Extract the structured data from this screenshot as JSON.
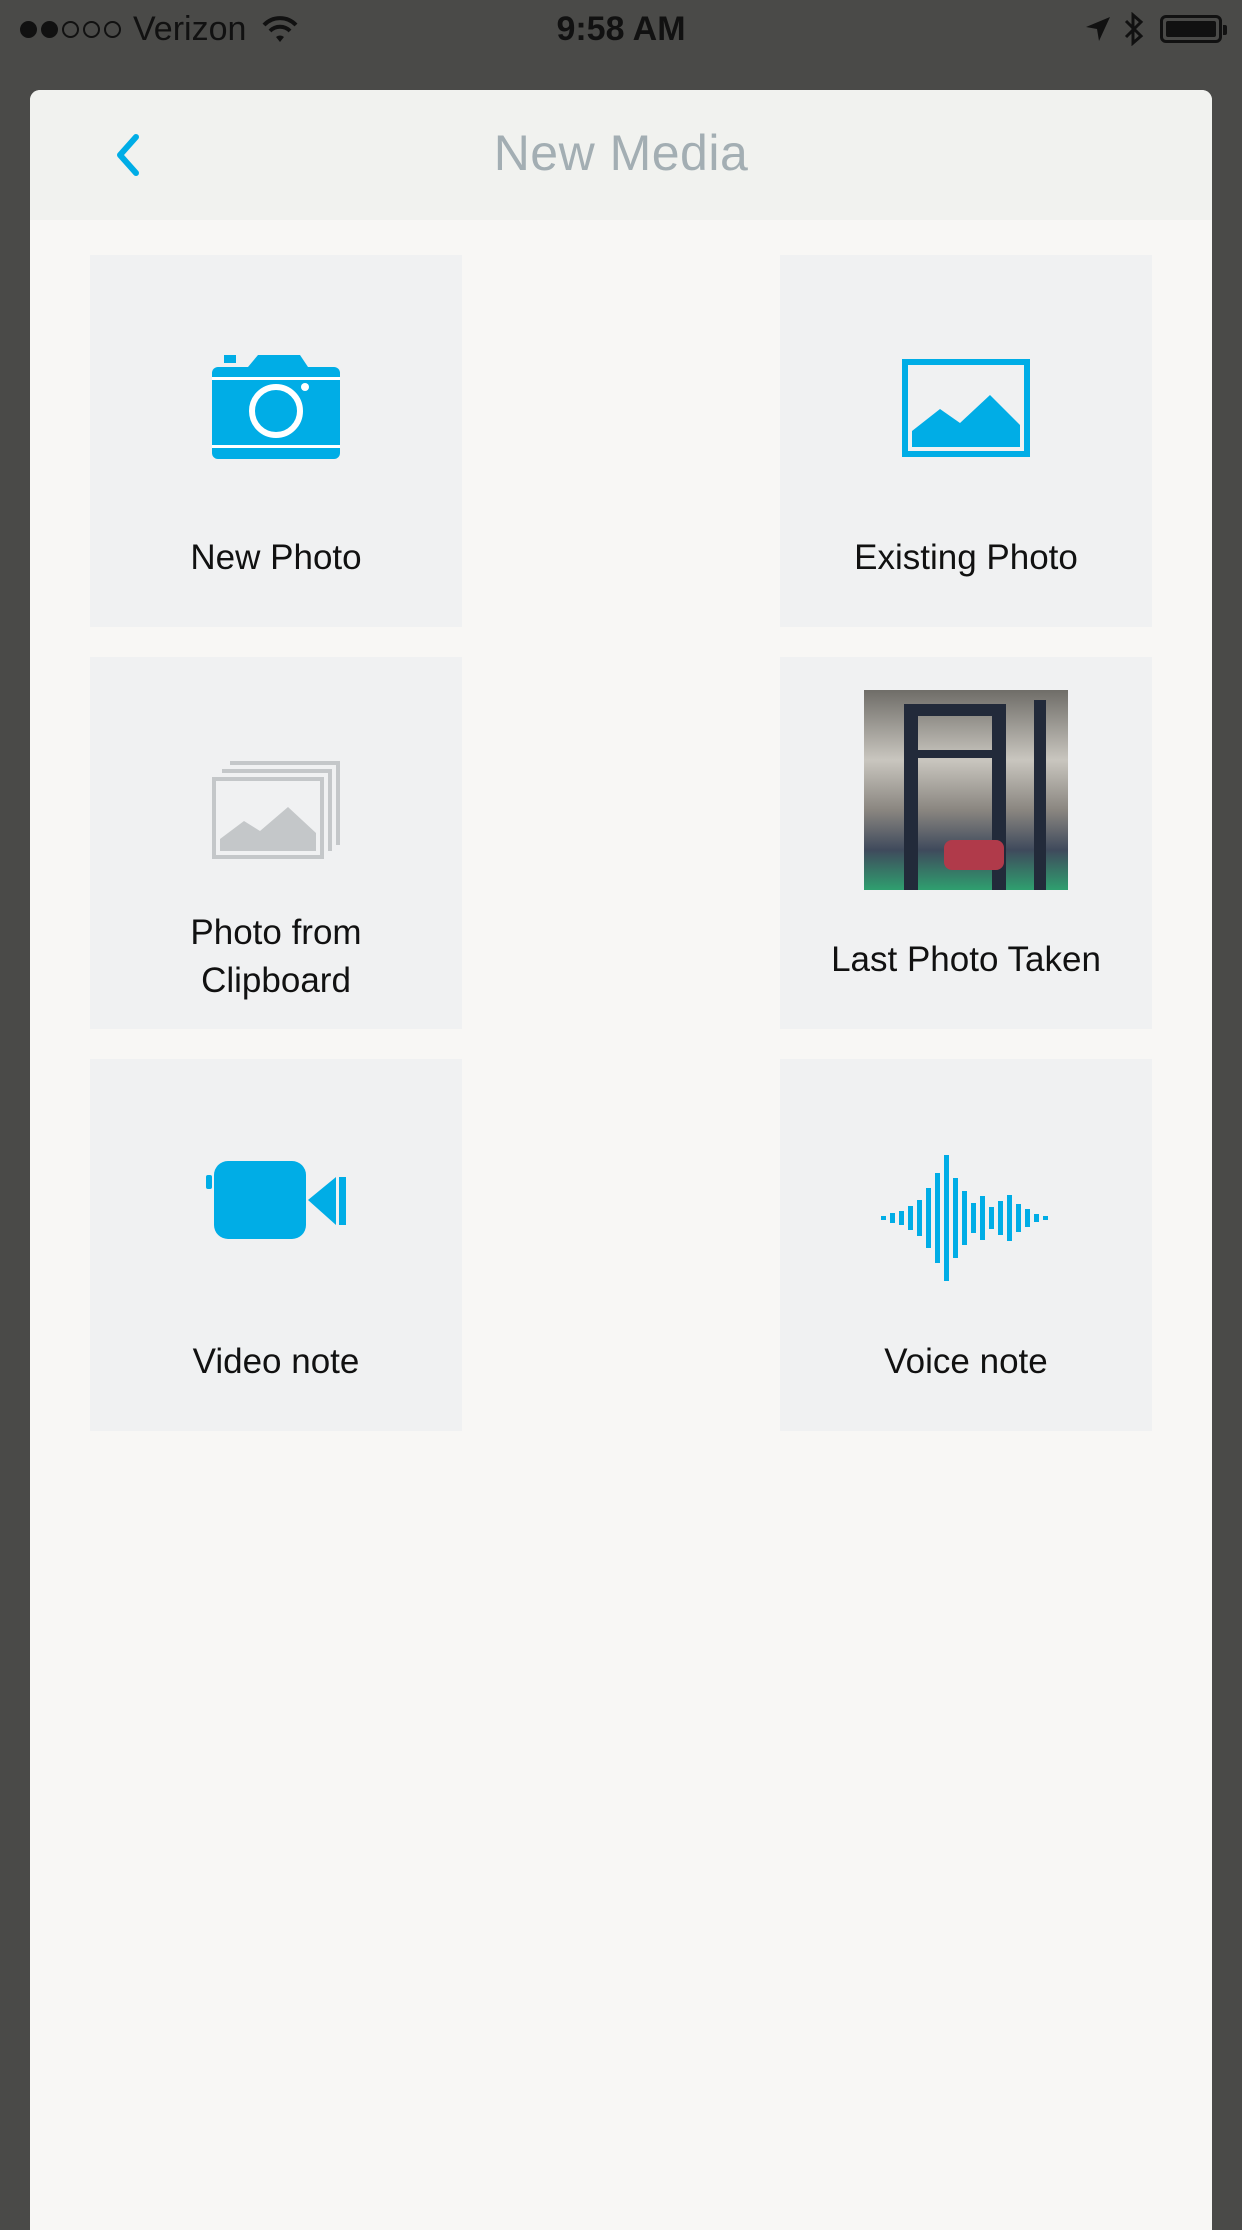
{
  "status_bar": {
    "carrier": "Verizon",
    "time": "9:58 AM",
    "signal_bars": 2,
    "signal_total": 5
  },
  "header": {
    "title": "New Media",
    "back_icon": "chevron-left-icon"
  },
  "tiles": [
    {
      "label": "New Photo",
      "icon": "camera-icon"
    },
    {
      "label": "Existing Photo",
      "icon": "image-icon"
    },
    {
      "label_line1": "Photo from",
      "label_line2": "Clipboard",
      "icon": "clipboard-images-icon"
    },
    {
      "label": "Last Photo Taken",
      "icon": "photo-thumbnail"
    },
    {
      "label": "Video note",
      "icon": "video-camera-icon"
    },
    {
      "label": "Voice note",
      "icon": "waveform-icon"
    }
  ],
  "colors": {
    "accent": "#00ade6",
    "muted_icon": "#c4c7c9",
    "title": "#a3aeb3",
    "tile_bg": "#f0f1f2",
    "modal_bg": "#f8f7f5",
    "backdrop": "#4a4a48"
  }
}
